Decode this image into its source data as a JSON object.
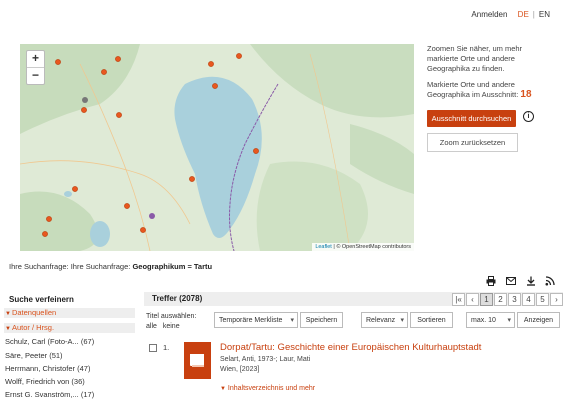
{
  "header": {
    "login": "Anmelden",
    "lang_de": "DE",
    "lang_en": "EN"
  },
  "map": {
    "zoom_in": "+",
    "zoom_out": "−",
    "attribution_leaflet": "Leaflet",
    "attribution_rest": "| © OpenStreetMap contributors"
  },
  "side": {
    "hint": "Zoomen Sie näher, um mehr markierte Orte und andere Geographika zu finden.",
    "marked_text": "Markierte Orte und andere Geographika im Ausschnitt:",
    "marked_count": "18",
    "search_button": "Ausschnitt durchsuchen",
    "reset_button": "Zoom zurücksetzen"
  },
  "query": {
    "prefix": "Ihre Suchanfrage: Ihre Suchanfrage:",
    "term": "Geographikum = Tartu"
  },
  "refine": {
    "title": "Suche verfeinern",
    "facets": [
      {
        "label": "Datenquellen"
      },
      {
        "label": "Autor / Hrsg."
      }
    ],
    "authors": [
      "Schulz, Carl (Foto-A... (67)",
      "Säre, Peeter (51)",
      "Herrmann, Christofer (47)",
      "Wolff, Friedrich von (36)",
      "Ernst G. Svanström,... (17)"
    ]
  },
  "results": {
    "title": "Treffer (2078)",
    "pagination": [
      "|«",
      "‹",
      "1",
      "2",
      "3",
      "4",
      "5",
      "›"
    ],
    "select_label": "Titel auswählen:",
    "select_all": "alle",
    "select_none": "keine",
    "watchlist": "Temporäre Merkliste",
    "save": "Speichern",
    "sort_by": "Relevanz",
    "sort_btn": "Sortieren",
    "per_page": "max. 10",
    "show_btn": "Anzeigen",
    "items": [
      {
        "num": "1.",
        "title": "Dorpat/Tartu: Geschichte einer Europäischen Kulturhauptstadt",
        "authors": "Selart, Anti, 1973-; Laur, Mati",
        "pub": "Wien, [2023]",
        "toc": "Inhaltsverzeichnis und mehr"
      }
    ]
  }
}
